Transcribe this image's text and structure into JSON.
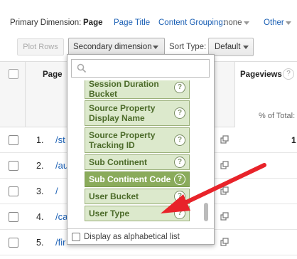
{
  "dimension_bar": {
    "label": "Primary Dimension:",
    "active": "Page",
    "options": [
      "Page Title",
      "Content Grouping:",
      "none"
    ],
    "other": "Other"
  },
  "toolbar": {
    "plot_rows": "Plot Rows",
    "secondary_dimension": "Secondary dimension",
    "sort_type_label": "Sort Type:",
    "sort_type_value": "Default"
  },
  "table": {
    "page_header": "Page",
    "pageviews_header": "Pageviews",
    "help": "?",
    "percent_of_total": "% of Total:",
    "rows": [
      {
        "num": "1.",
        "path": "/st",
        "value": "1"
      },
      {
        "num": "2.",
        "path": "/au"
      },
      {
        "num": "3.",
        "path": "/"
      },
      {
        "num": "4.",
        "path": "/ca"
      },
      {
        "num": "5.",
        "path": "/fir"
      }
    ]
  },
  "dropdown": {
    "search_placeholder": "",
    "items": [
      {
        "label": "Session Duration Bucket",
        "selected": false
      },
      {
        "label": "Source Property Display Name",
        "selected": false
      },
      {
        "label": "Source Property Tracking ID",
        "selected": false
      },
      {
        "label": "Sub Continent",
        "selected": false
      },
      {
        "label": "Sub Continent Code",
        "selected": true
      },
      {
        "label": "User Bucket",
        "selected": false
      },
      {
        "label": "User Type",
        "selected": false
      }
    ],
    "help_glyph": "?",
    "alphabetical_label": "Display as alphabetical list"
  },
  "colors": {
    "link": "#1a5fb4",
    "item_bg": "#dce9cc",
    "item_selected_bg": "#8aab5b",
    "arrow": "#e8232a"
  }
}
